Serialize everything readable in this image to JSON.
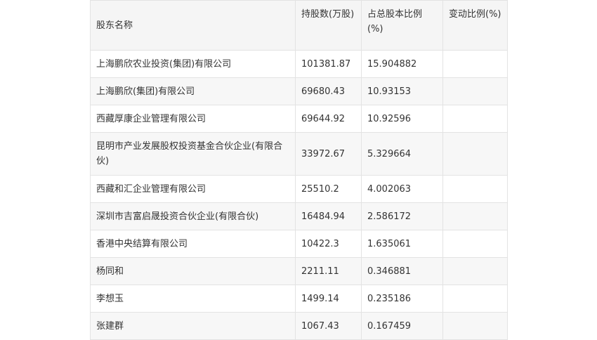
{
  "table": {
    "headers": [
      "股东名称",
      "持股数(万股)",
      "占总股本比例(%)",
      "变动比例(%)"
    ],
    "rows": [
      [
        "上海鹏欣农业投资(集团)有限公司",
        "101381.87",
        "15.904882",
        ""
      ],
      [
        "上海鹏欣(集团)有限公司",
        "69680.43",
        "10.93153",
        ""
      ],
      [
        "西藏厚康企业管理有限公司",
        "69644.92",
        "10.92596",
        ""
      ],
      [
        "昆明市产业发展股权投资基金合伙企业(有限合伙)",
        "33972.67",
        "5.329664",
        ""
      ],
      [
        "西藏和汇企业管理有限公司",
        "25510.2",
        "4.002063",
        ""
      ],
      [
        "深圳市吉富启晟投资合伙企业(有限合伙)",
        "16484.94",
        "2.586172",
        ""
      ],
      [
        "香港中央结算有限公司",
        "10422.3",
        "1.635061",
        ""
      ],
      [
        "杨同和",
        "2211.11",
        "0.346881",
        ""
      ],
      [
        "李想玉",
        "1499.14",
        "0.235186",
        ""
      ],
      [
        "张建群",
        "1067.43",
        "0.167459",
        ""
      ]
    ]
  }
}
